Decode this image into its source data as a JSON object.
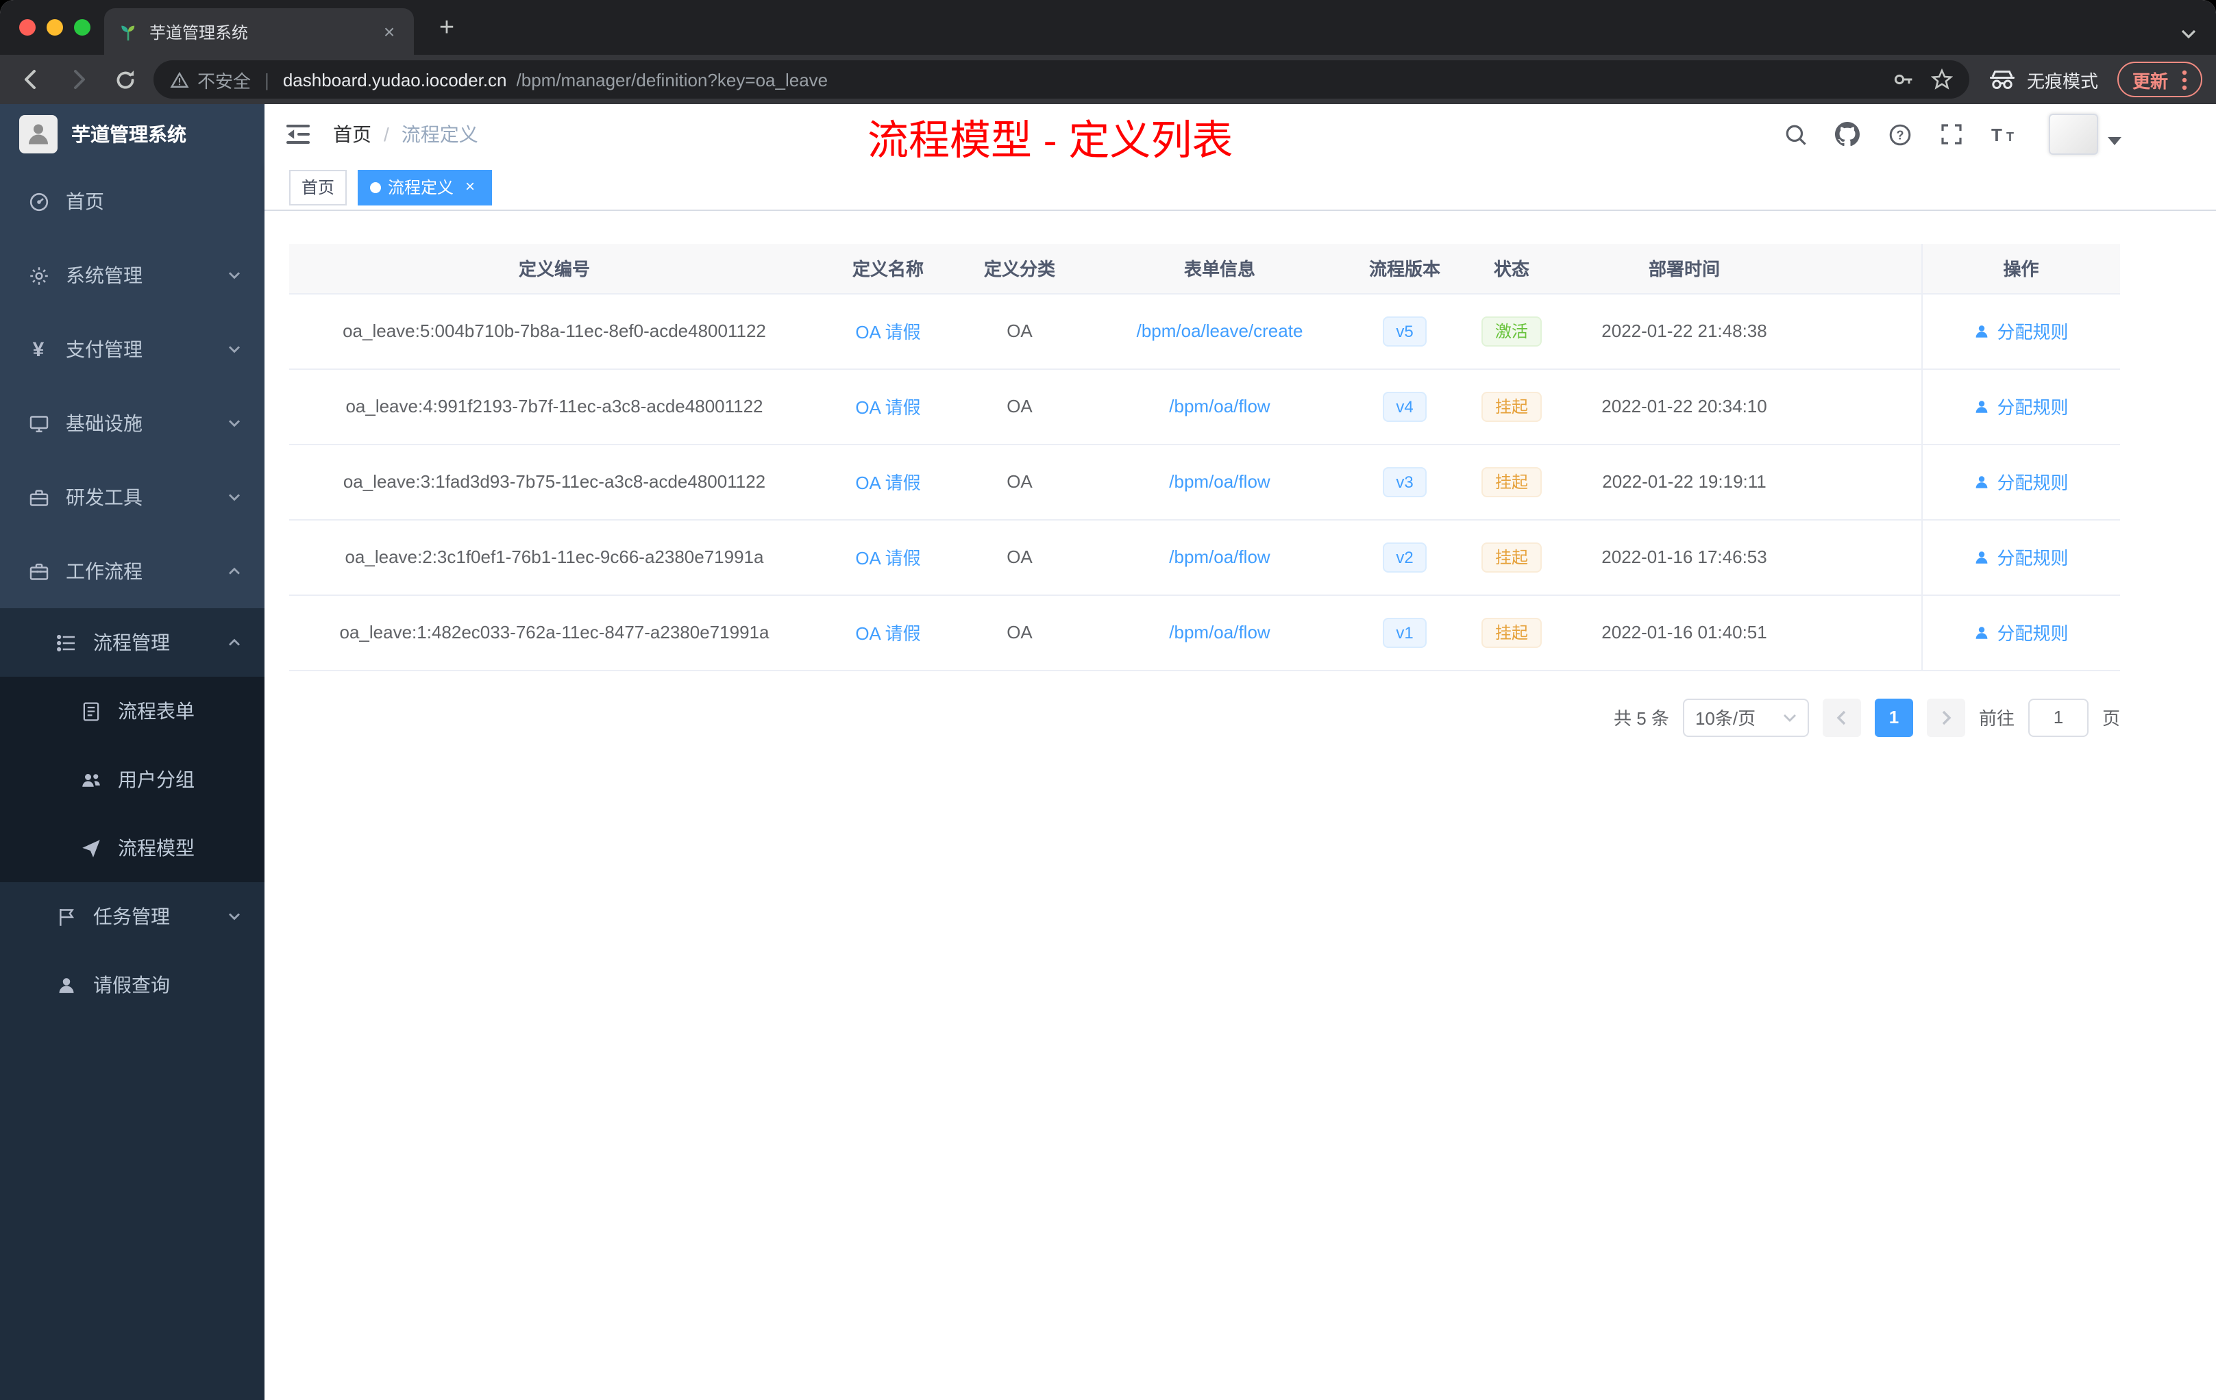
{
  "colors": {
    "accent": "#409eff",
    "success": "#67c23a",
    "warning": "#e6a23c",
    "annotation": "#ff0000",
    "sidebar_bg": "#304156",
    "submenu_bg": "#1f2d3d"
  },
  "browser": {
    "tab_title": "芋道管理系统",
    "new_tab": "+",
    "close_tab": "×",
    "security_label": "不安全",
    "url_host": "dashboard.yudao.iocoder.cn",
    "url_path": "/bpm/manager/definition?key=oa_leave",
    "incognito_label": "无痕模式",
    "update_label": "更新"
  },
  "sidebar": {
    "logo_title": "芋道管理系统",
    "items": [
      {
        "key": "home",
        "label": "首页",
        "icon": "dashboard-icon",
        "level": 1
      },
      {
        "key": "system",
        "label": "系统管理",
        "icon": "gear-icon",
        "level": 1,
        "chevron": "down"
      },
      {
        "key": "payment",
        "label": "支付管理",
        "icon": "yen-icon",
        "level": 1,
        "chevron": "down"
      },
      {
        "key": "infra",
        "label": "基础设施",
        "icon": "monitor-icon",
        "level": 1,
        "chevron": "down"
      },
      {
        "key": "devtools",
        "label": "研发工具",
        "icon": "toolbox-icon",
        "level": 1,
        "chevron": "down"
      },
      {
        "key": "workflow",
        "label": "工作流程",
        "icon": "briefcase-icon",
        "level": 1,
        "chevron": "up"
      },
      {
        "key": "process-manage",
        "label": "流程管理",
        "icon": "list-icon",
        "level": 2,
        "chevron": "up"
      },
      {
        "key": "process-form",
        "label": "流程表单",
        "icon": "form-icon",
        "level": 3
      },
      {
        "key": "user-group",
        "label": "用户分组",
        "icon": "usergroup-icon",
        "level": 3
      },
      {
        "key": "process-model",
        "label": "流程模型",
        "icon": "send-icon",
        "level": 3
      },
      {
        "key": "task-manage",
        "label": "任务管理",
        "icon": "task-icon",
        "level": 2,
        "chevron": "down"
      },
      {
        "key": "leave-query",
        "label": "请假查询",
        "icon": "user-icon",
        "level": 2
      }
    ]
  },
  "header": {
    "breadcrumb_home": "首页",
    "breadcrumb_sep": "/",
    "breadcrumb_current": "流程定义",
    "annotation": "流程模型 - 定义列表"
  },
  "tags": [
    {
      "label": "首页",
      "active": false
    },
    {
      "label": "流程定义",
      "active": true
    }
  ],
  "table": {
    "columns": [
      "定义编号",
      "定义名称",
      "定义分类",
      "表单信息",
      "流程版本",
      "状态",
      "部署时间",
      "操作"
    ],
    "rows": [
      {
        "id": "oa_leave:5:004b710b-7b8a-11ec-8ef0-acde48001122",
        "name": "OA 请假",
        "category": "OA",
        "form": "/bpm/oa/leave/create",
        "version": "v5",
        "status": "激活",
        "status_type": "success",
        "deploy_time": "2022-01-22 21:48:38",
        "action": "分配规则"
      },
      {
        "id": "oa_leave:4:991f2193-7b7f-11ec-a3c8-acde48001122",
        "name": "OA 请假",
        "category": "OA",
        "form": "/bpm/oa/flow",
        "version": "v4",
        "status": "挂起",
        "status_type": "warning",
        "deploy_time": "2022-01-22 20:34:10",
        "action": "分配规则"
      },
      {
        "id": "oa_leave:3:1fad3d93-7b75-11ec-a3c8-acde48001122",
        "name": "OA 请假",
        "category": "OA",
        "form": "/bpm/oa/flow",
        "version": "v3",
        "status": "挂起",
        "status_type": "warning",
        "deploy_time": "2022-01-22 19:19:11",
        "action": "分配规则"
      },
      {
        "id": "oa_leave:2:3c1f0ef1-76b1-11ec-9c66-a2380e71991a",
        "name": "OA 请假",
        "category": "OA",
        "form": "/bpm/oa/flow",
        "version": "v2",
        "status": "挂起",
        "status_type": "warning",
        "deploy_time": "2022-01-16 17:46:53",
        "action": "分配规则"
      },
      {
        "id": "oa_leave:1:482ec033-762a-11ec-8477-a2380e71991a",
        "name": "OA 请假",
        "category": "OA",
        "form": "/bpm/oa/flow",
        "version": "v1",
        "status": "挂起",
        "status_type": "warning",
        "deploy_time": "2022-01-16 01:40:51",
        "action": "分配规则"
      }
    ]
  },
  "pagination": {
    "total": "共 5 条",
    "page_size": "10条/页",
    "current_page": "1",
    "goto_label": "前往",
    "goto_value": "1",
    "goto_suffix": "页"
  }
}
